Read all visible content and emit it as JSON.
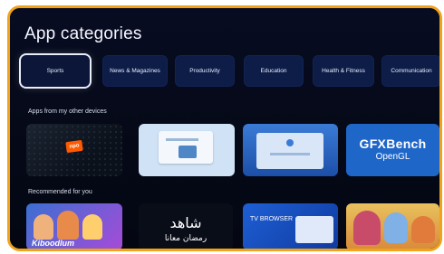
{
  "page": {
    "title": "App categories"
  },
  "categories": [
    {
      "label": "Sports",
      "selected": true
    },
    {
      "label": "News & Magazines"
    },
    {
      "label": "Productivity"
    },
    {
      "label": "Education"
    },
    {
      "label": "Health & Fitness"
    },
    {
      "label": "Communication"
    }
  ],
  "sections": {
    "apps_from_devices": "Apps from my other devices",
    "recommended": "Recommended for you"
  },
  "apps_from_devices": [
    {
      "badge": "npo"
    },
    {},
    {},
    {
      "title": "GFXBench",
      "subtitle": "OpenGL"
    }
  ],
  "recommended": [
    {
      "caption": "Kiboodlum"
    },
    {
      "arabic_title": "شاهد",
      "arabic_subtitle": "رمضان معانا"
    },
    {
      "title": "TV BROWSER"
    },
    {}
  ],
  "colors": {
    "accent_border": "#f0a21b",
    "background": "#060a1c",
    "tile": "#0d1d48"
  }
}
